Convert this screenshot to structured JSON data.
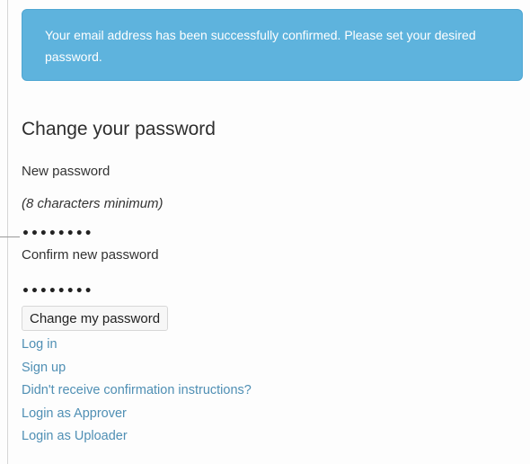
{
  "alert": {
    "message": "Your email address has been successfully confirmed. Please set your desired password.",
    "color": "#5eb3dd"
  },
  "form": {
    "title": "Change your password",
    "new_password_label": "New password",
    "new_password_hint": "(8 characters minimum)",
    "new_password_value": "••••••••",
    "confirm_password_label": "Confirm new password",
    "confirm_password_value": "••••••••",
    "submit_label": "Change my password"
  },
  "links": {
    "log_in": "Log in",
    "sign_up": "Sign up",
    "resend_confirmation": "Didn't receive confirmation instructions?",
    "login_approver": "Login as Approver",
    "login_uploader": "Login as Uploader",
    "color": "#4f8fb4"
  }
}
